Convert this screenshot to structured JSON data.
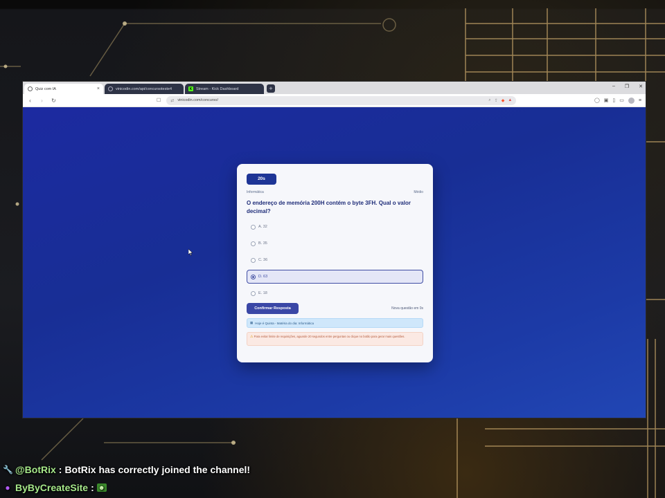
{
  "browser": {
    "tabs": [
      {
        "label": "Quiz com IA",
        "active": true,
        "icon": "globe-icon"
      },
      {
        "label": "vinicodin.com/api/concursoteste4",
        "active": false,
        "icon": "globe-icon"
      },
      {
        "label": "Stream - Kick Dashboard",
        "active": false,
        "icon": "kick-icon"
      }
    ],
    "new_tab_label": "+",
    "window_controls": {
      "minimize": "–",
      "maximize": "❐",
      "close": "✕"
    },
    "url": "vinicodin.com/concurso/"
  },
  "quiz": {
    "timer": "20s",
    "category": "Informática",
    "difficulty": "Médio",
    "question": "O endereço de memória 200H contém o byte 3FH. Qual o valor decimal?",
    "options": [
      {
        "label": "A. 32",
        "selected": false
      },
      {
        "label": "B. 35",
        "selected": false
      },
      {
        "label": "C. 36",
        "selected": false
      },
      {
        "label": "D. 63",
        "selected": true
      },
      {
        "label": "E. 18",
        "selected": false
      }
    ],
    "confirm_label": "Confirmar Resposta",
    "next_question_note": "Nova questão em 0s",
    "info_text": "Hoje é Quinta - Matéria do dia: Informática",
    "warning_text": "Para evitar limite de requisições, aguarde 20 segundos entre perguntas ou clique no botão para gerar mais questões."
  },
  "chat": {
    "messages": [
      {
        "user": "@BotRix",
        "separator": ":",
        "text": "BotRix has correctly joined the channel!",
        "badge": "wrench-icon"
      },
      {
        "user": "ByByCreateSite",
        "separator": ":",
        "text": "",
        "badge": "mic-icon",
        "emote": "emote-icon"
      }
    ]
  },
  "colors": {
    "page_bg_start": "#1c2aa0",
    "page_bg_end": "#2146b4",
    "accent": "#3a47a6",
    "timer_bg": "#1e3596",
    "chat_user": "#a6e88a"
  }
}
